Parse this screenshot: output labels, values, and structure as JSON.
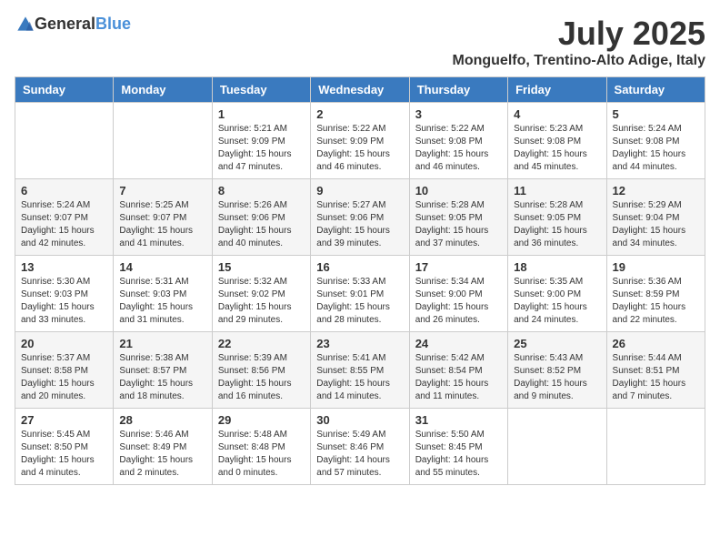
{
  "header": {
    "logo_general": "General",
    "logo_blue": "Blue",
    "month_year": "July 2025",
    "location": "Monguelfo, Trentino-Alto Adige, Italy"
  },
  "weekdays": [
    "Sunday",
    "Monday",
    "Tuesday",
    "Wednesday",
    "Thursday",
    "Friday",
    "Saturday"
  ],
  "weeks": [
    [
      {
        "day": "",
        "sunrise": "",
        "sunset": "",
        "daylight": ""
      },
      {
        "day": "",
        "sunrise": "",
        "sunset": "",
        "daylight": ""
      },
      {
        "day": "1",
        "sunrise": "Sunrise: 5:21 AM",
        "sunset": "Sunset: 9:09 PM",
        "daylight": "Daylight: 15 hours and 47 minutes."
      },
      {
        "day": "2",
        "sunrise": "Sunrise: 5:22 AM",
        "sunset": "Sunset: 9:09 PM",
        "daylight": "Daylight: 15 hours and 46 minutes."
      },
      {
        "day": "3",
        "sunrise": "Sunrise: 5:22 AM",
        "sunset": "Sunset: 9:08 PM",
        "daylight": "Daylight: 15 hours and 46 minutes."
      },
      {
        "day": "4",
        "sunrise": "Sunrise: 5:23 AM",
        "sunset": "Sunset: 9:08 PM",
        "daylight": "Daylight: 15 hours and 45 minutes."
      },
      {
        "day": "5",
        "sunrise": "Sunrise: 5:24 AM",
        "sunset": "Sunset: 9:08 PM",
        "daylight": "Daylight: 15 hours and 44 minutes."
      }
    ],
    [
      {
        "day": "6",
        "sunrise": "Sunrise: 5:24 AM",
        "sunset": "Sunset: 9:07 PM",
        "daylight": "Daylight: 15 hours and 42 minutes."
      },
      {
        "day": "7",
        "sunrise": "Sunrise: 5:25 AM",
        "sunset": "Sunset: 9:07 PM",
        "daylight": "Daylight: 15 hours and 41 minutes."
      },
      {
        "day": "8",
        "sunrise": "Sunrise: 5:26 AM",
        "sunset": "Sunset: 9:06 PM",
        "daylight": "Daylight: 15 hours and 40 minutes."
      },
      {
        "day": "9",
        "sunrise": "Sunrise: 5:27 AM",
        "sunset": "Sunset: 9:06 PM",
        "daylight": "Daylight: 15 hours and 39 minutes."
      },
      {
        "day": "10",
        "sunrise": "Sunrise: 5:28 AM",
        "sunset": "Sunset: 9:05 PM",
        "daylight": "Daylight: 15 hours and 37 minutes."
      },
      {
        "day": "11",
        "sunrise": "Sunrise: 5:28 AM",
        "sunset": "Sunset: 9:05 PM",
        "daylight": "Daylight: 15 hours and 36 minutes."
      },
      {
        "day": "12",
        "sunrise": "Sunrise: 5:29 AM",
        "sunset": "Sunset: 9:04 PM",
        "daylight": "Daylight: 15 hours and 34 minutes."
      }
    ],
    [
      {
        "day": "13",
        "sunrise": "Sunrise: 5:30 AM",
        "sunset": "Sunset: 9:03 PM",
        "daylight": "Daylight: 15 hours and 33 minutes."
      },
      {
        "day": "14",
        "sunrise": "Sunrise: 5:31 AM",
        "sunset": "Sunset: 9:03 PM",
        "daylight": "Daylight: 15 hours and 31 minutes."
      },
      {
        "day": "15",
        "sunrise": "Sunrise: 5:32 AM",
        "sunset": "Sunset: 9:02 PM",
        "daylight": "Daylight: 15 hours and 29 minutes."
      },
      {
        "day": "16",
        "sunrise": "Sunrise: 5:33 AM",
        "sunset": "Sunset: 9:01 PM",
        "daylight": "Daylight: 15 hours and 28 minutes."
      },
      {
        "day": "17",
        "sunrise": "Sunrise: 5:34 AM",
        "sunset": "Sunset: 9:00 PM",
        "daylight": "Daylight: 15 hours and 26 minutes."
      },
      {
        "day": "18",
        "sunrise": "Sunrise: 5:35 AM",
        "sunset": "Sunset: 9:00 PM",
        "daylight": "Daylight: 15 hours and 24 minutes."
      },
      {
        "day": "19",
        "sunrise": "Sunrise: 5:36 AM",
        "sunset": "Sunset: 8:59 PM",
        "daylight": "Daylight: 15 hours and 22 minutes."
      }
    ],
    [
      {
        "day": "20",
        "sunrise": "Sunrise: 5:37 AM",
        "sunset": "Sunset: 8:58 PM",
        "daylight": "Daylight: 15 hours and 20 minutes."
      },
      {
        "day": "21",
        "sunrise": "Sunrise: 5:38 AM",
        "sunset": "Sunset: 8:57 PM",
        "daylight": "Daylight: 15 hours and 18 minutes."
      },
      {
        "day": "22",
        "sunrise": "Sunrise: 5:39 AM",
        "sunset": "Sunset: 8:56 PM",
        "daylight": "Daylight: 15 hours and 16 minutes."
      },
      {
        "day": "23",
        "sunrise": "Sunrise: 5:41 AM",
        "sunset": "Sunset: 8:55 PM",
        "daylight": "Daylight: 15 hours and 14 minutes."
      },
      {
        "day": "24",
        "sunrise": "Sunrise: 5:42 AM",
        "sunset": "Sunset: 8:54 PM",
        "daylight": "Daylight: 15 hours and 11 minutes."
      },
      {
        "day": "25",
        "sunrise": "Sunrise: 5:43 AM",
        "sunset": "Sunset: 8:52 PM",
        "daylight": "Daylight: 15 hours and 9 minutes."
      },
      {
        "day": "26",
        "sunrise": "Sunrise: 5:44 AM",
        "sunset": "Sunset: 8:51 PM",
        "daylight": "Daylight: 15 hours and 7 minutes."
      }
    ],
    [
      {
        "day": "27",
        "sunrise": "Sunrise: 5:45 AM",
        "sunset": "Sunset: 8:50 PM",
        "daylight": "Daylight: 15 hours and 4 minutes."
      },
      {
        "day": "28",
        "sunrise": "Sunrise: 5:46 AM",
        "sunset": "Sunset: 8:49 PM",
        "daylight": "Daylight: 15 hours and 2 minutes."
      },
      {
        "day": "29",
        "sunrise": "Sunrise: 5:48 AM",
        "sunset": "Sunset: 8:48 PM",
        "daylight": "Daylight: 15 hours and 0 minutes."
      },
      {
        "day": "30",
        "sunrise": "Sunrise: 5:49 AM",
        "sunset": "Sunset: 8:46 PM",
        "daylight": "Daylight: 14 hours and 57 minutes."
      },
      {
        "day": "31",
        "sunrise": "Sunrise: 5:50 AM",
        "sunset": "Sunset: 8:45 PM",
        "daylight": "Daylight: 14 hours and 55 minutes."
      },
      {
        "day": "",
        "sunrise": "",
        "sunset": "",
        "daylight": ""
      },
      {
        "day": "",
        "sunrise": "",
        "sunset": "",
        "daylight": ""
      }
    ]
  ]
}
